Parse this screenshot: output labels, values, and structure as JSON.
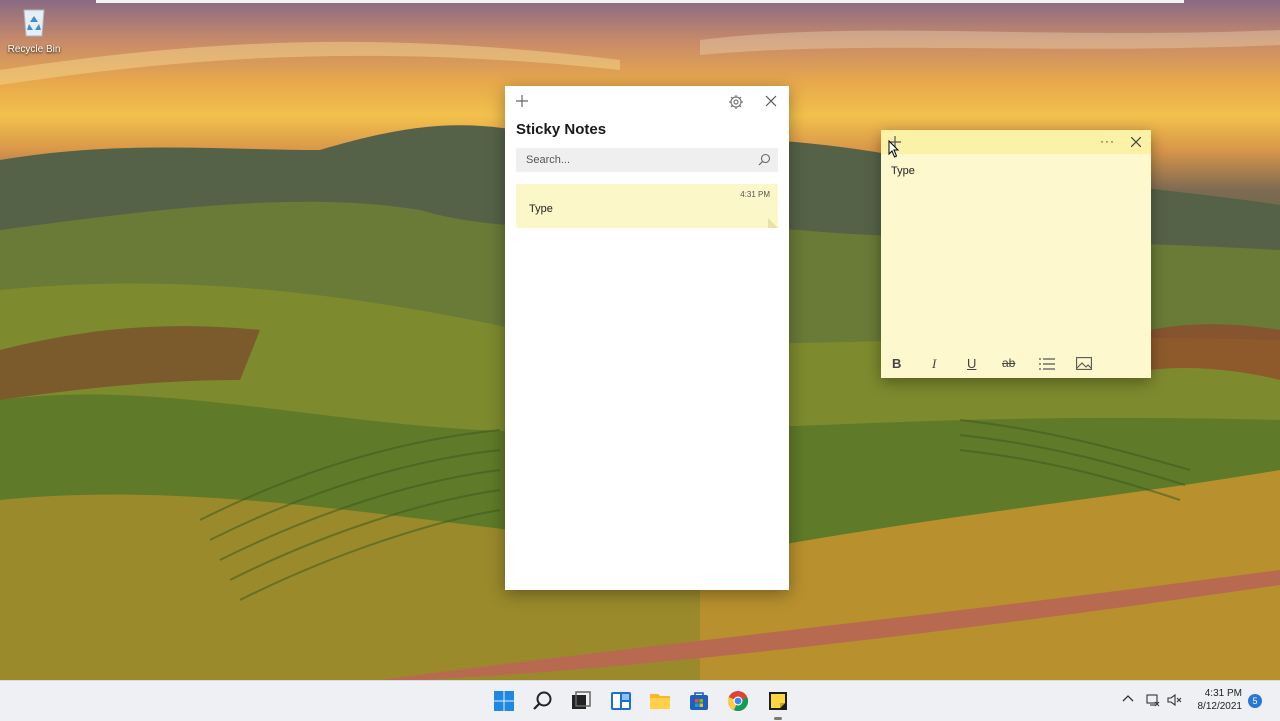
{
  "desktop": {
    "recycle_bin_label": "Recycle Bin"
  },
  "sticky_notes": {
    "title": "Sticky Notes",
    "search_placeholder": "Search...",
    "notes": [
      {
        "time": "4:31 PM",
        "text": "Type"
      }
    ]
  },
  "note_window": {
    "more_label": "···",
    "body_text": "Type",
    "format_bold": "B",
    "format_italic": "I",
    "format_underline": "U",
    "format_strike": "ab"
  },
  "taskbar": {
    "time": "4:31 PM",
    "date": "8/12/2021",
    "notification_count": "5",
    "icons": [
      "start-icon",
      "search-icon",
      "task-view-icon",
      "widgets-icon",
      "file-explorer-icon",
      "store-icon",
      "chrome-icon",
      "sticky-notes-icon"
    ]
  },
  "colors": {
    "note_yellow": "#fdf8cd",
    "note_header": "#fbf2a8",
    "taskbar_bg": "#eef0f4",
    "accent_blue": "#2677d9"
  }
}
